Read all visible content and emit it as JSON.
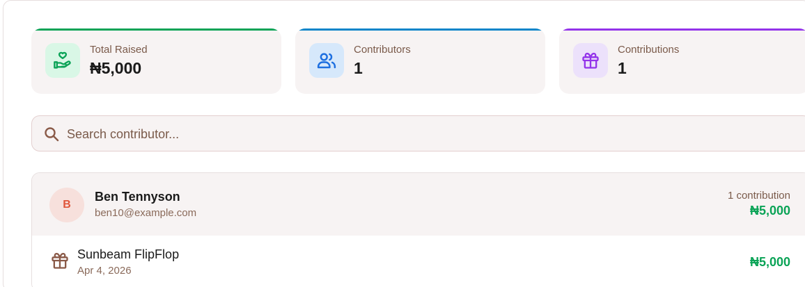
{
  "stats": [
    {
      "label": "Total Raised",
      "value": "₦5,000",
      "icon": "hand-heart-icon",
      "accent": "#0aa356"
    },
    {
      "label": "Contributors",
      "value": "1",
      "icon": "users-icon",
      "accent": "#0b85c9"
    },
    {
      "label": "Contributions",
      "value": "1",
      "icon": "gift-icon",
      "accent": "#9333ea"
    }
  ],
  "search": {
    "placeholder": "Search contributor..."
  },
  "contributors": [
    {
      "initial": "B",
      "name": "Ben Tennyson",
      "email": "ben10@example.com",
      "count": "1 contribution",
      "total": "₦5,000",
      "items": [
        {
          "name": "Sunbeam FlipFlop",
          "date": "Apr 4, 2026",
          "amount": "₦5,000",
          "icon": "gift-icon"
        }
      ]
    }
  ]
}
